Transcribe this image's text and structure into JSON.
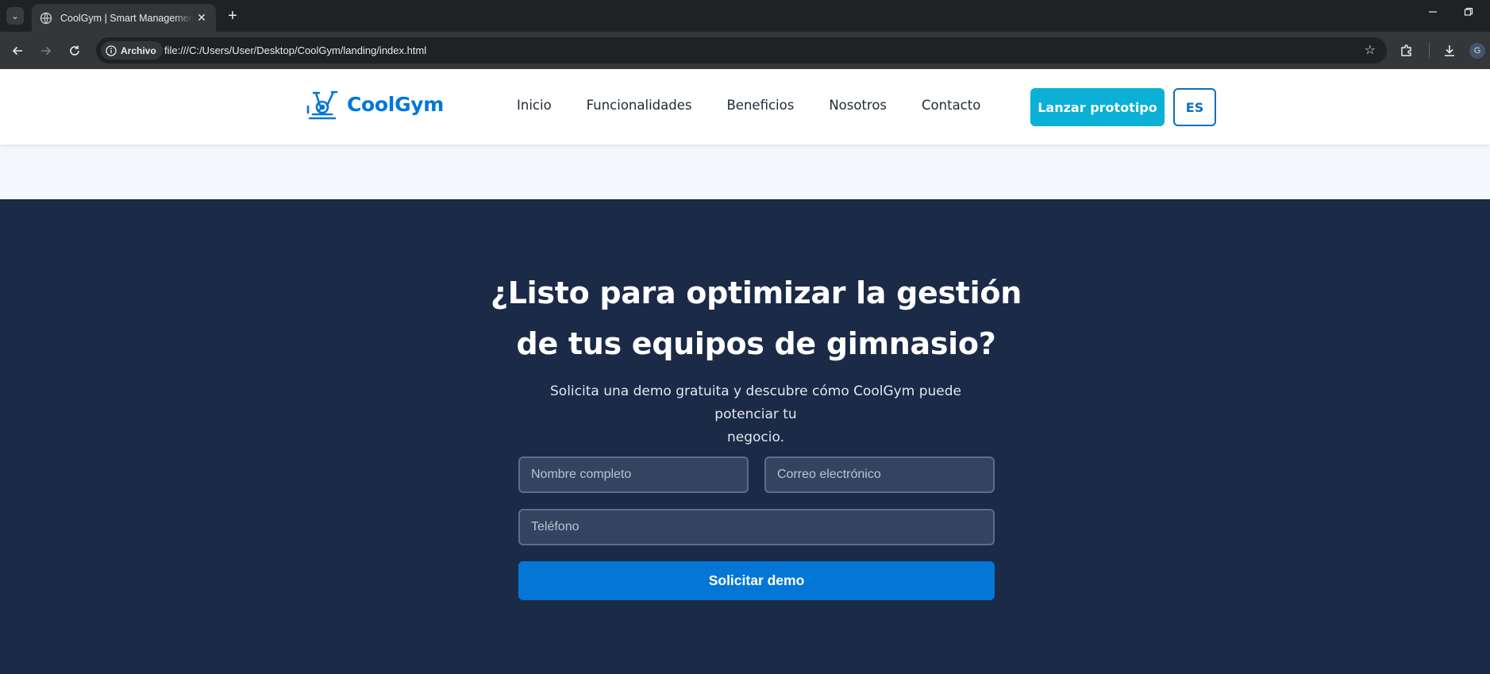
{
  "browser": {
    "tab_title": "CoolGym | Smart Management",
    "tab_close": "✕",
    "new_tab": "+",
    "security_chip": "Archivo",
    "url": "file:///C:/Users/User/Desktop/CoolGym/landing/index.html",
    "profile_initial": "G"
  },
  "header": {
    "brand": "CoolGym",
    "nav": [
      "Inicio",
      "Funcionalidades",
      "Beneficios",
      "Nosotros",
      "Contacto"
    ],
    "cta_label": "Lanzar prototipo",
    "lang_label": "ES"
  },
  "contact": {
    "headline_line1": "¿Listo para optimizar la gestión",
    "headline_line2": "de tus equipos de gimnasio?",
    "subtitle_line1": "Solicita una demo gratuita y descubre cómo CoolGym puede potenciar tu",
    "subtitle_line2": "negocio.",
    "name_placeholder": "Nombre completo",
    "email_placeholder": "Correo electrónico",
    "phone_placeholder": "Teléfono",
    "submit_label": "Solicitar demo"
  },
  "colors": {
    "brand": "#0077d9",
    "cta": "#0ab0d5",
    "section_bg": "#1b2a47",
    "submit": "#0477d6"
  }
}
